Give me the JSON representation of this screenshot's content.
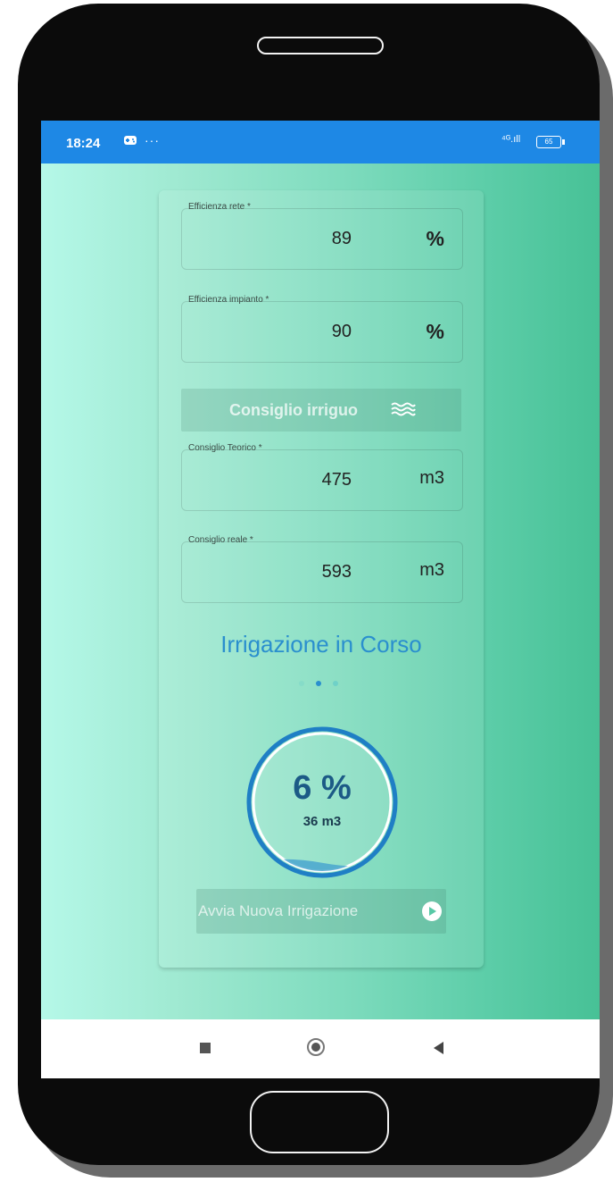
{
  "status_bar": {
    "time": "18:24",
    "more": "···",
    "signal": "⁴ᴳ.ıll",
    "battery": "65"
  },
  "fields": {
    "efficienza_rete": {
      "label": "Efficienza rete *",
      "value": "89",
      "unit": "%"
    },
    "efficienza_impianto": {
      "label": "Efficienza impianto *",
      "value": "90",
      "unit": "%"
    },
    "consiglio_teorico": {
      "label": "Consiglio Teorico *",
      "value": "475",
      "unit": "m3"
    },
    "consiglio_reale": {
      "label": "Consiglio reale *",
      "value": "593",
      "unit": "m3"
    }
  },
  "advice_button": {
    "label": "Consiglio irriguo",
    "icon": "waves-icon"
  },
  "status_title": "Irrigazione in Corso",
  "progress": {
    "percent_label": "6 %",
    "volume_label": "36 m3",
    "fraction": 0.06
  },
  "start_button": {
    "label": "Avvia Nuova Irrigazione",
    "icon": "play-icon"
  },
  "pager": {
    "count": 3,
    "active": 1
  },
  "colors": {
    "status_bar": "#1e88e5",
    "accent_title": "#2a8fce",
    "gauge_ring": "#1f7fc5",
    "gauge_text": "#1c5a86"
  }
}
